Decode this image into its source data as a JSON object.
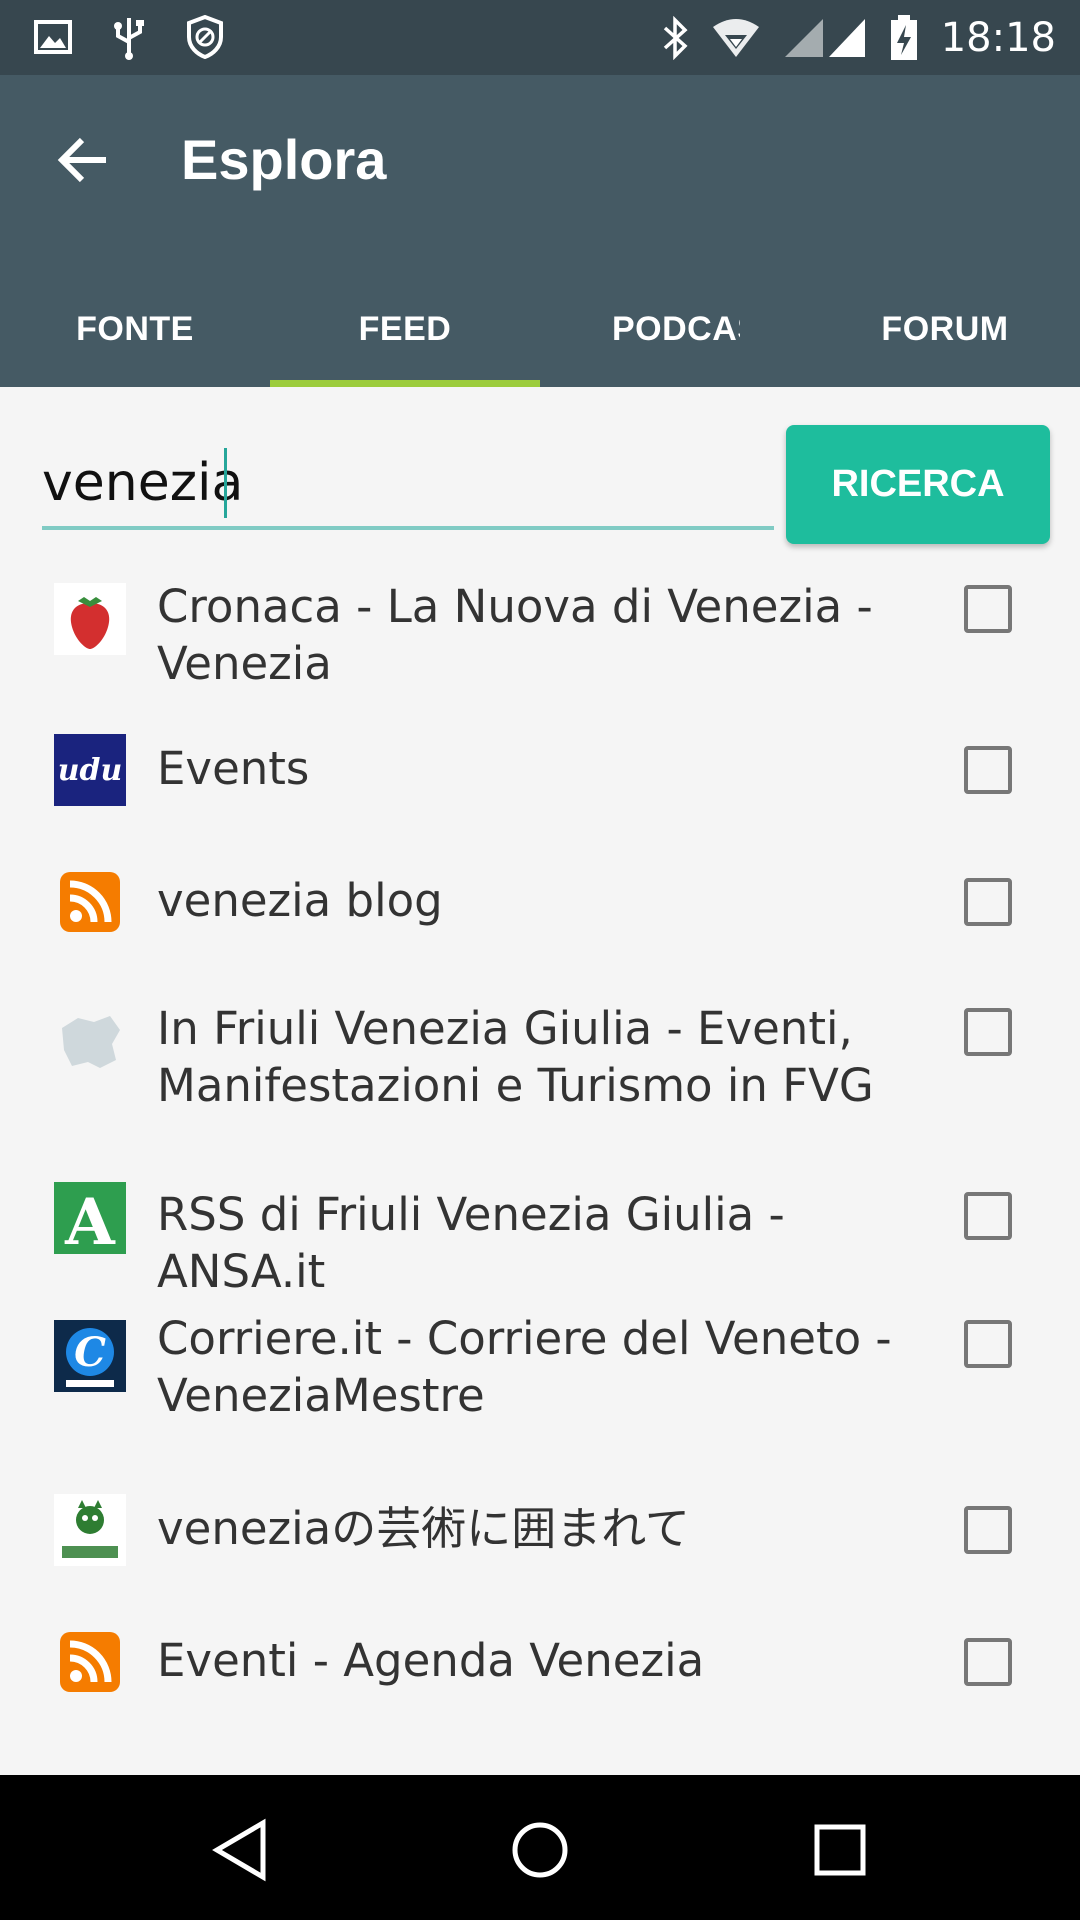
{
  "status_bar": {
    "time": "18:18",
    "left_icons": [
      "image-icon",
      "usb-icon",
      "block-icon"
    ],
    "right_icons": [
      "bluetooth-icon",
      "wifi-icon",
      "signal-icon",
      "battery-charging-icon"
    ]
  },
  "app_bar": {
    "title": "Esplora"
  },
  "tabs": [
    {
      "label": "FONTE",
      "selected": false
    },
    {
      "label": "FEED",
      "selected": true
    },
    {
      "label": "PODCAS",
      "selected": false
    },
    {
      "label": "FORUM",
      "selected": false
    }
  ],
  "colors": {
    "status_bar": "#37474f",
    "app_bar": "#455a64",
    "tab_indicator": "#9ccc3c",
    "accent": "#1ebd9d"
  },
  "search": {
    "value": "venezia",
    "button_label": "RICERCA"
  },
  "results": [
    {
      "label": "Cronaca - La Nuova di Venezia - Venezia",
      "icon": "strawberry-icon",
      "checked": false
    },
    {
      "label": "Events",
      "icon": "udu-logo-icon",
      "checked": false
    },
    {
      "label": "venezia blog",
      "icon": "rss-icon",
      "checked": false
    },
    {
      "label": "In Friuli Venezia Giulia - Eventi, Manifestazioni e Turismo in FVG",
      "icon": "map-region-icon",
      "checked": false
    },
    {
      "label": "RSS di Friuli Venezia Giulia - ANSA.it",
      "icon": "ansa-logo-icon",
      "checked": false
    },
    {
      "label": "Corriere.it - Corriere del Veneto - VeneziaMestre",
      "icon": "corriere-logo-icon",
      "checked": false
    },
    {
      "label": "veneziaの芸術に囲まれて",
      "icon": "ameba-logo-icon",
      "checked": false
    },
    {
      "label": "Eventi - Agenda Venezia",
      "icon": "rss-icon",
      "checked": false
    }
  ],
  "nav_bar": {
    "buttons": [
      "back-triangle-icon",
      "home-circle-icon",
      "recents-square-icon"
    ]
  }
}
